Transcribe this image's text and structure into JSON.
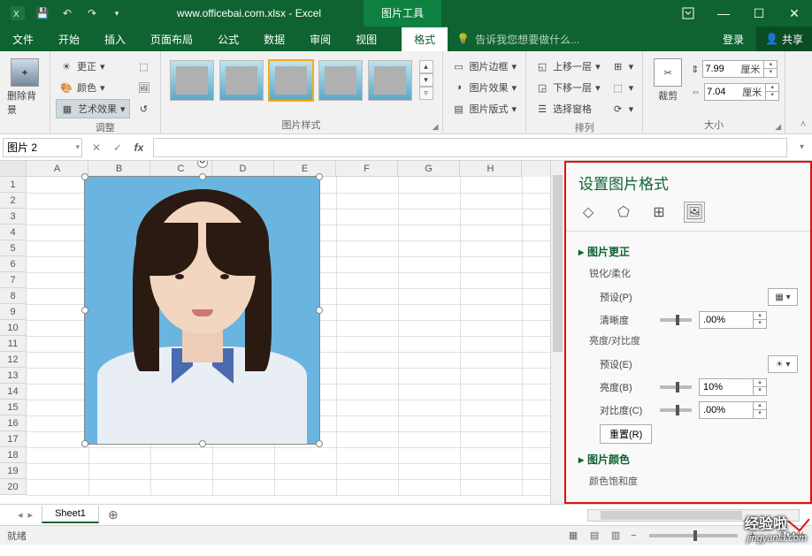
{
  "titlebar": {
    "title": "www.officebai.com.xlsx - Excel",
    "contextual_tab": "图片工具"
  },
  "tabs": {
    "file": "文件",
    "home": "开始",
    "insert": "插入",
    "layout": "页面布局",
    "formulas": "公式",
    "data": "数据",
    "review": "审阅",
    "view": "视图",
    "format": "格式",
    "tellme_placeholder": "告诉我您想要做什么...",
    "signin": "登录",
    "share": "共享"
  },
  "ribbon": {
    "remove_bg": "删除背景",
    "corrections": "更正",
    "color": "颜色",
    "artistic": "艺术效果",
    "adjust_label": "调整",
    "styles_label": "图片样式",
    "border": "图片边框",
    "effects": "图片效果",
    "layout_pic": "图片版式",
    "bring_fwd": "上移一层",
    "send_back": "下移一层",
    "selection": "选择窗格",
    "arrange_label": "排列",
    "crop": "裁剪",
    "height": "7.99",
    "width": "7.04",
    "unit": "厘米",
    "size_label": "大小"
  },
  "namebox": "图片 2",
  "columns": [
    "A",
    "B",
    "C",
    "D",
    "E",
    "F",
    "G",
    "H"
  ],
  "rows": [
    "1",
    "2",
    "3",
    "4",
    "5",
    "6",
    "7",
    "8",
    "9",
    "10",
    "11",
    "12",
    "13",
    "14",
    "15",
    "16",
    "17",
    "18",
    "19",
    "20"
  ],
  "taskpane": {
    "title": "设置图片格式",
    "sec_corrections": "图片更正",
    "sharpen_soften": "锐化/柔化",
    "preset_p": "预设(P)",
    "sharpness": "清晰度",
    "sharpness_val": ".00%",
    "bright_contrast": "亮度/对比度",
    "preset_e": "预设(E)",
    "brightness": "亮度(B)",
    "brightness_val": "10%",
    "contrast": "对比度(C)",
    "contrast_val": ".00%",
    "reset": "重置(R)",
    "sec_color": "图片颜色",
    "saturation": "颜色饱和度"
  },
  "sheettabs": {
    "sheet1": "Sheet1"
  },
  "status": {
    "ready": "就绪",
    "zoom": "100%"
  },
  "watermark": {
    "l1": "经验啦",
    "l2": "jingyanla.com"
  }
}
